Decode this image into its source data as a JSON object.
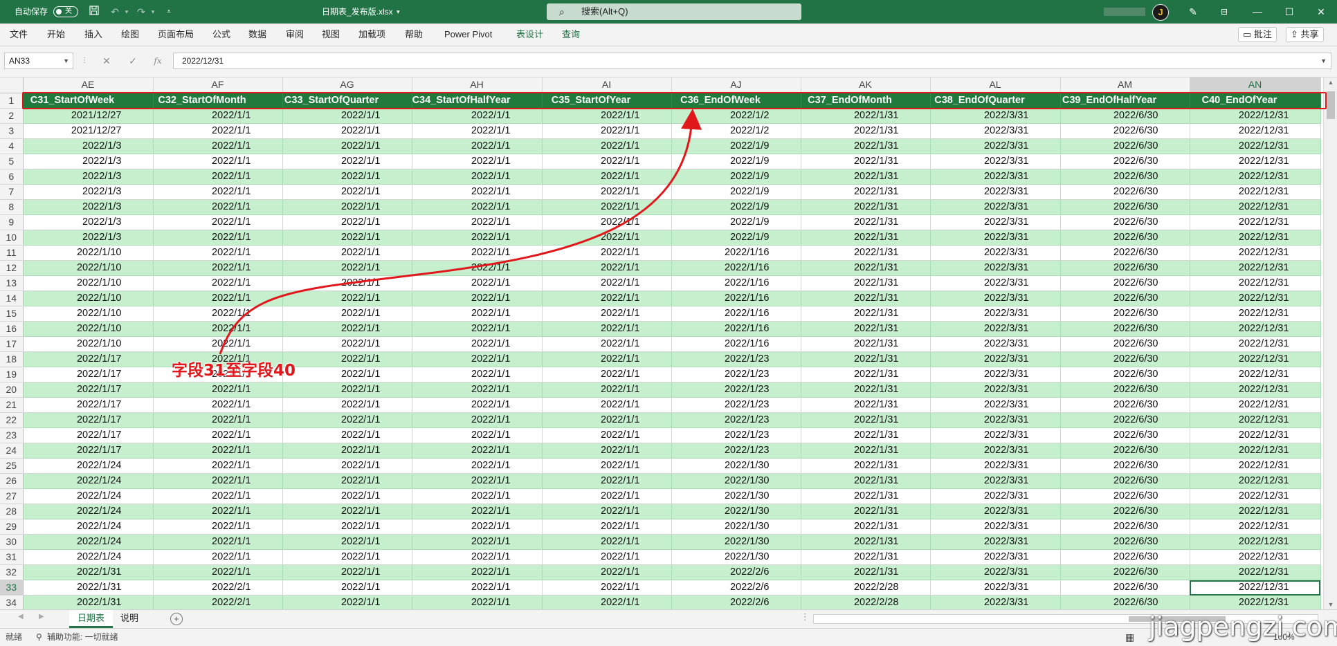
{
  "titlebar": {
    "autosave_label": "自动保存",
    "autosave_state": "关",
    "doc_title": "日期表_发布版.xlsx",
    "search_placeholder": "搜索(Alt+Q)",
    "avatar_initial": "J",
    "bg_color": "#217346"
  },
  "menu": {
    "items": [
      "文件",
      "开始",
      "插入",
      "绘图",
      "页面布局",
      "公式",
      "数据",
      "审阅",
      "视图",
      "加载项",
      "帮助",
      "Power Pivot",
      "表设计",
      "查询"
    ],
    "comments_label": "批注",
    "share_label": "共享"
  },
  "formula": {
    "namebox": "AN33",
    "fx_symbol": "fx",
    "value": "2022/12/31"
  },
  "sheet": {
    "columns": [
      "AE",
      "AF",
      "AG",
      "AH",
      "AI",
      "AJ",
      "AK",
      "AL",
      "AM",
      "AN"
    ],
    "selected_column": "AN",
    "headers": [
      "C31_StartOfWeek",
      "C32_StartOfMonth",
      "C33_StartOfQuarter",
      "C34_StartOfHalfYear",
      "C35_StartOfYear",
      "C36_EndOfWeek",
      "C37_EndOfMonth",
      "C38_EndOfQuarter",
      "C39_EndOfHalfYear",
      "C40_EndOfYear"
    ],
    "selected_row": 33,
    "rows": [
      {
        "n": "2",
        "v": [
          "2021/12/27",
          "2022/1/1",
          "2022/1/1",
          "2022/1/1",
          "2022/1/1",
          "2022/1/2",
          "2022/1/31",
          "2022/3/31",
          "2022/6/30",
          "2022/12/31"
        ]
      },
      {
        "n": "3",
        "v": [
          "2021/12/27",
          "2022/1/1",
          "2022/1/1",
          "2022/1/1",
          "2022/1/1",
          "2022/1/2",
          "2022/1/31",
          "2022/3/31",
          "2022/6/30",
          "2022/12/31"
        ]
      },
      {
        "n": "4",
        "v": [
          "2022/1/3",
          "2022/1/1",
          "2022/1/1",
          "2022/1/1",
          "2022/1/1",
          "2022/1/9",
          "2022/1/31",
          "2022/3/31",
          "2022/6/30",
          "2022/12/31"
        ]
      },
      {
        "n": "5",
        "v": [
          "2022/1/3",
          "2022/1/1",
          "2022/1/1",
          "2022/1/1",
          "2022/1/1",
          "2022/1/9",
          "2022/1/31",
          "2022/3/31",
          "2022/6/30",
          "2022/12/31"
        ]
      },
      {
        "n": "6",
        "v": [
          "2022/1/3",
          "2022/1/1",
          "2022/1/1",
          "2022/1/1",
          "2022/1/1",
          "2022/1/9",
          "2022/1/31",
          "2022/3/31",
          "2022/6/30",
          "2022/12/31"
        ]
      },
      {
        "n": "7",
        "v": [
          "2022/1/3",
          "2022/1/1",
          "2022/1/1",
          "2022/1/1",
          "2022/1/1",
          "2022/1/9",
          "2022/1/31",
          "2022/3/31",
          "2022/6/30",
          "2022/12/31"
        ]
      },
      {
        "n": "8",
        "v": [
          "2022/1/3",
          "2022/1/1",
          "2022/1/1",
          "2022/1/1",
          "2022/1/1",
          "2022/1/9",
          "2022/1/31",
          "2022/3/31",
          "2022/6/30",
          "2022/12/31"
        ]
      },
      {
        "n": "9",
        "v": [
          "2022/1/3",
          "2022/1/1",
          "2022/1/1",
          "2022/1/1",
          "2022/1/1",
          "2022/1/9",
          "2022/1/31",
          "2022/3/31",
          "2022/6/30",
          "2022/12/31"
        ]
      },
      {
        "n": "10",
        "v": [
          "2022/1/3",
          "2022/1/1",
          "2022/1/1",
          "2022/1/1",
          "2022/1/1",
          "2022/1/9",
          "2022/1/31",
          "2022/3/31",
          "2022/6/30",
          "2022/12/31"
        ]
      },
      {
        "n": "11",
        "v": [
          "2022/1/10",
          "2022/1/1",
          "2022/1/1",
          "2022/1/1",
          "2022/1/1",
          "2022/1/16",
          "2022/1/31",
          "2022/3/31",
          "2022/6/30",
          "2022/12/31"
        ]
      },
      {
        "n": "12",
        "v": [
          "2022/1/10",
          "2022/1/1",
          "2022/1/1",
          "2022/1/1",
          "2022/1/1",
          "2022/1/16",
          "2022/1/31",
          "2022/3/31",
          "2022/6/30",
          "2022/12/31"
        ]
      },
      {
        "n": "13",
        "v": [
          "2022/1/10",
          "2022/1/1",
          "2022/1/1",
          "2022/1/1",
          "2022/1/1",
          "2022/1/16",
          "2022/1/31",
          "2022/3/31",
          "2022/6/30",
          "2022/12/31"
        ]
      },
      {
        "n": "14",
        "v": [
          "2022/1/10",
          "2022/1/1",
          "2022/1/1",
          "2022/1/1",
          "2022/1/1",
          "2022/1/16",
          "2022/1/31",
          "2022/3/31",
          "2022/6/30",
          "2022/12/31"
        ]
      },
      {
        "n": "15",
        "v": [
          "2022/1/10",
          "2022/1/1",
          "2022/1/1",
          "2022/1/1",
          "2022/1/1",
          "2022/1/16",
          "2022/1/31",
          "2022/3/31",
          "2022/6/30",
          "2022/12/31"
        ]
      },
      {
        "n": "16",
        "v": [
          "2022/1/10",
          "2022/1/1",
          "2022/1/1",
          "2022/1/1",
          "2022/1/1",
          "2022/1/16",
          "2022/1/31",
          "2022/3/31",
          "2022/6/30",
          "2022/12/31"
        ]
      },
      {
        "n": "17",
        "v": [
          "2022/1/10",
          "2022/1/1",
          "2022/1/1",
          "2022/1/1",
          "2022/1/1",
          "2022/1/16",
          "2022/1/31",
          "2022/3/31",
          "2022/6/30",
          "2022/12/31"
        ]
      },
      {
        "n": "18",
        "v": [
          "2022/1/17",
          "2022/1/1",
          "2022/1/1",
          "2022/1/1",
          "2022/1/1",
          "2022/1/23",
          "2022/1/31",
          "2022/3/31",
          "2022/6/30",
          "2022/12/31"
        ]
      },
      {
        "n": "19",
        "v": [
          "2022/1/17",
          "2022/1/1",
          "2022/1/1",
          "2022/1/1",
          "2022/1/1",
          "2022/1/23",
          "2022/1/31",
          "2022/3/31",
          "2022/6/30",
          "2022/12/31"
        ]
      },
      {
        "n": "20",
        "v": [
          "2022/1/17",
          "2022/1/1",
          "2022/1/1",
          "2022/1/1",
          "2022/1/1",
          "2022/1/23",
          "2022/1/31",
          "2022/3/31",
          "2022/6/30",
          "2022/12/31"
        ]
      },
      {
        "n": "21",
        "v": [
          "2022/1/17",
          "2022/1/1",
          "2022/1/1",
          "2022/1/1",
          "2022/1/1",
          "2022/1/23",
          "2022/1/31",
          "2022/3/31",
          "2022/6/30",
          "2022/12/31"
        ]
      },
      {
        "n": "22",
        "v": [
          "2022/1/17",
          "2022/1/1",
          "2022/1/1",
          "2022/1/1",
          "2022/1/1",
          "2022/1/23",
          "2022/1/31",
          "2022/3/31",
          "2022/6/30",
          "2022/12/31"
        ]
      },
      {
        "n": "23",
        "v": [
          "2022/1/17",
          "2022/1/1",
          "2022/1/1",
          "2022/1/1",
          "2022/1/1",
          "2022/1/23",
          "2022/1/31",
          "2022/3/31",
          "2022/6/30",
          "2022/12/31"
        ]
      },
      {
        "n": "24",
        "v": [
          "2022/1/17",
          "2022/1/1",
          "2022/1/1",
          "2022/1/1",
          "2022/1/1",
          "2022/1/23",
          "2022/1/31",
          "2022/3/31",
          "2022/6/30",
          "2022/12/31"
        ]
      },
      {
        "n": "25",
        "v": [
          "2022/1/24",
          "2022/1/1",
          "2022/1/1",
          "2022/1/1",
          "2022/1/1",
          "2022/1/30",
          "2022/1/31",
          "2022/3/31",
          "2022/6/30",
          "2022/12/31"
        ]
      },
      {
        "n": "26",
        "v": [
          "2022/1/24",
          "2022/1/1",
          "2022/1/1",
          "2022/1/1",
          "2022/1/1",
          "2022/1/30",
          "2022/1/31",
          "2022/3/31",
          "2022/6/30",
          "2022/12/31"
        ]
      },
      {
        "n": "27",
        "v": [
          "2022/1/24",
          "2022/1/1",
          "2022/1/1",
          "2022/1/1",
          "2022/1/1",
          "2022/1/30",
          "2022/1/31",
          "2022/3/31",
          "2022/6/30",
          "2022/12/31"
        ]
      },
      {
        "n": "28",
        "v": [
          "2022/1/24",
          "2022/1/1",
          "2022/1/1",
          "2022/1/1",
          "2022/1/1",
          "2022/1/30",
          "2022/1/31",
          "2022/3/31",
          "2022/6/30",
          "2022/12/31"
        ]
      },
      {
        "n": "29",
        "v": [
          "2022/1/24",
          "2022/1/1",
          "2022/1/1",
          "2022/1/1",
          "2022/1/1",
          "2022/1/30",
          "2022/1/31",
          "2022/3/31",
          "2022/6/30",
          "2022/12/31"
        ]
      },
      {
        "n": "30",
        "v": [
          "2022/1/24",
          "2022/1/1",
          "2022/1/1",
          "2022/1/1",
          "2022/1/1",
          "2022/1/30",
          "2022/1/31",
          "2022/3/31",
          "2022/6/30",
          "2022/12/31"
        ]
      },
      {
        "n": "31",
        "v": [
          "2022/1/24",
          "2022/1/1",
          "2022/1/1",
          "2022/1/1",
          "2022/1/1",
          "2022/1/30",
          "2022/1/31",
          "2022/3/31",
          "2022/6/30",
          "2022/12/31"
        ]
      },
      {
        "n": "32",
        "v": [
          "2022/1/31",
          "2022/1/1",
          "2022/1/1",
          "2022/1/1",
          "2022/1/1",
          "2022/2/6",
          "2022/1/31",
          "2022/3/31",
          "2022/6/30",
          "2022/12/31"
        ]
      },
      {
        "n": "33",
        "v": [
          "2022/1/31",
          "2022/2/1",
          "2022/1/1",
          "2022/1/1",
          "2022/1/1",
          "2022/2/6",
          "2022/2/28",
          "2022/3/31",
          "2022/6/30",
          "2022/12/31"
        ]
      },
      {
        "n": "34",
        "v": [
          "2022/1/31",
          "2022/2/1",
          "2022/1/1",
          "2022/1/1",
          "2022/1/1",
          "2022/2/6",
          "2022/2/28",
          "2022/3/31",
          "2022/6/30",
          "2022/12/31"
        ]
      }
    ],
    "band_color": "#c6efce",
    "header_color": "#1f7a3c"
  },
  "tabs": {
    "sheets": [
      "日期表",
      "说明"
    ],
    "active": "日期表"
  },
  "status": {
    "ready": "就绪",
    "accessibility": "辅助功能: 一切就绪",
    "zoom": "100%"
  },
  "annotation": {
    "label": "字段31至字段40",
    "color": "#e0181b"
  },
  "watermark": "jiagpengzi.com"
}
